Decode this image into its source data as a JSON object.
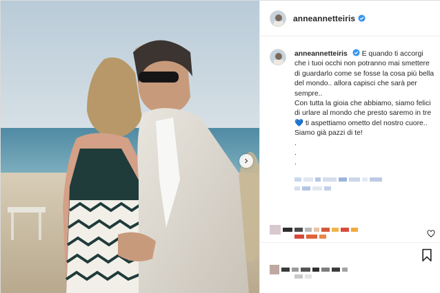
{
  "post": {
    "username": "anneannetteiris",
    "verified": true,
    "caption_lines": [
      "E quando ti accorgi che i tuoi occhi non potranno mai smettere di guardarlo come se fosse la cosa più bella del mondo.. allora capisci che sarà per sempre..",
      "Con tutta la gioia che abbiamo, siamo felici di urlare al mondo che presto saremo in tre",
      "ti aspettiamo ometto del nostro cuore..",
      "Siamo già pazzi di te!"
    ],
    "heart_emoji": "💙",
    "dots": [
      ".",
      ".",
      "."
    ]
  },
  "colors": {
    "verified_blue": "#3897f0",
    "heart_blue": "#3f8fe6"
  },
  "icons": {
    "verified": "verified-badge-icon",
    "like": "heart-outline-icon",
    "save": "bookmark-icon",
    "next": "chevron-right-icon"
  }
}
